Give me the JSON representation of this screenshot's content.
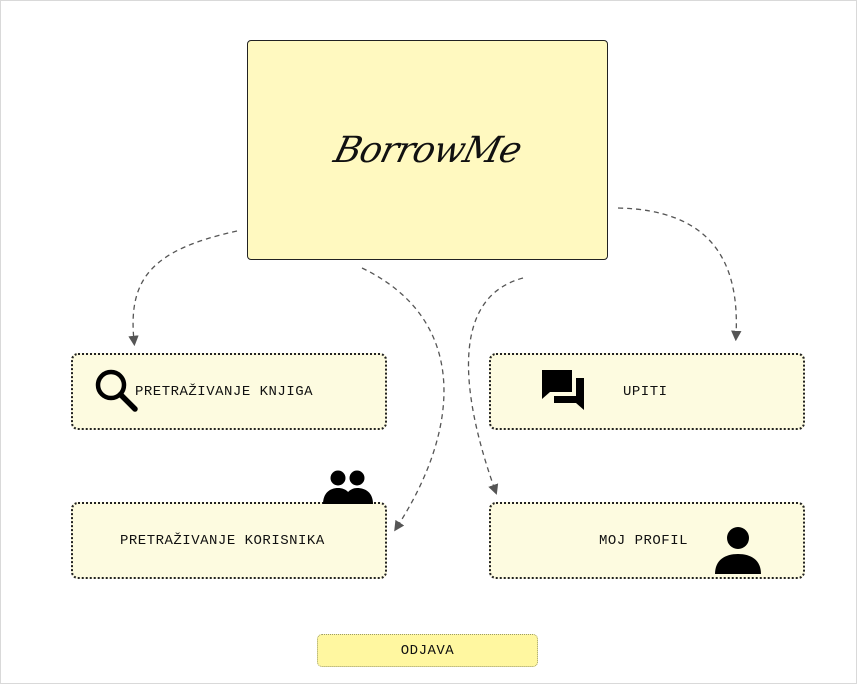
{
  "app": {
    "logo_text": "BorrowMe"
  },
  "menu": {
    "search_books": {
      "label": "PRETRAŽIVANJE KNJIGA",
      "icon": "search-icon"
    },
    "inquiries": {
      "label": "UPITI",
      "icon": "chat-bubbles-icon"
    },
    "search_users": {
      "label": "PRETRAŽIVANJE KORISNIKA",
      "icon": "group-icon"
    },
    "my_profile": {
      "label": "MOJ PROFIL",
      "icon": "person-icon"
    }
  },
  "logout": {
    "label": "ODJAVA"
  },
  "colors": {
    "logo_card_bg": "#fff9c0",
    "nav_card_bg": "#fdfbe0",
    "logout_bg": "#fff7a0"
  }
}
